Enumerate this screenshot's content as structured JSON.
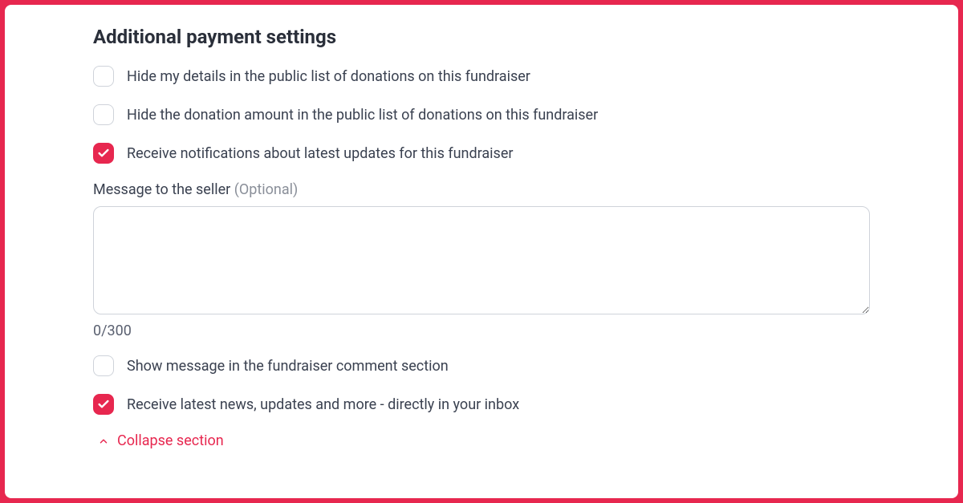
{
  "section": {
    "title": "Additional payment settings"
  },
  "options": {
    "hide_details": {
      "label": "Hide my details in the public list of donations on this fundraiser",
      "checked": false
    },
    "hide_amount": {
      "label": "Hide the donation amount in the public list of donations on this fundraiser",
      "checked": false
    },
    "receive_updates": {
      "label": "Receive notifications about latest updates for this fundraiser",
      "checked": true
    },
    "show_message": {
      "label": "Show message in the fundraiser comment section",
      "checked": false
    },
    "receive_news": {
      "label": "Receive latest news, updates and more - directly in your inbox",
      "checked": true
    }
  },
  "message": {
    "label": "Message to the seller ",
    "optional": "(Optional)",
    "value": "",
    "count": "0/300"
  },
  "collapse": {
    "label": "Collapse section"
  },
  "colors": {
    "accent": "#e7274f"
  }
}
